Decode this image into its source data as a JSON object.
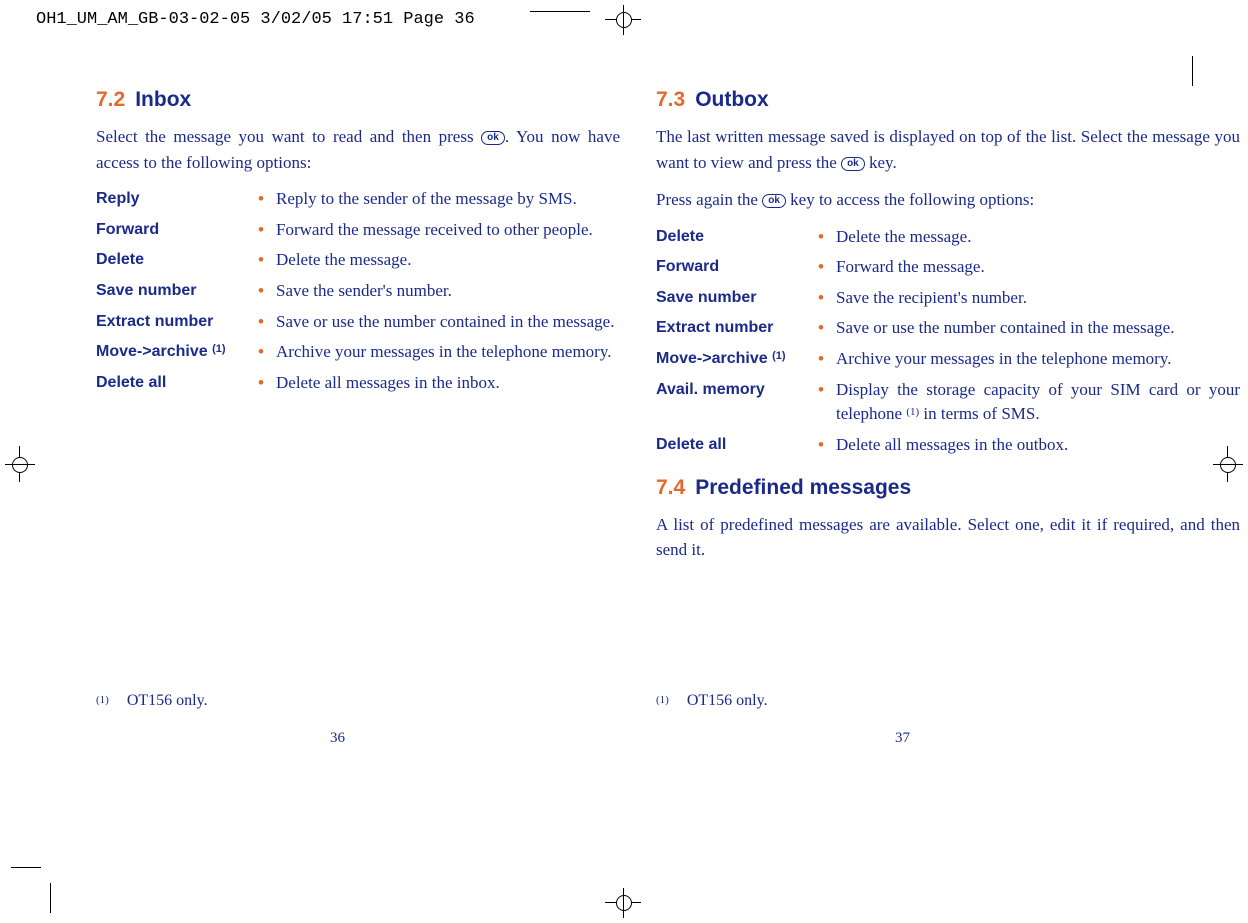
{
  "print_header": "OH1_UM_AM_GB-03-02-05   3/02/05  17:51  Page 36",
  "left": {
    "section_num": "7.2",
    "section_title": "Inbox",
    "intro_before_key": "Select the message you want to read and then press ",
    "ok_label": "ok",
    "intro_after_key": ". You now have access to the following options:",
    "options": [
      {
        "term": "Reply",
        "desc": "Reply to the sender of the message by SMS.",
        "justify": false
      },
      {
        "term": "Forward",
        "desc": "Forward the message received to other people.",
        "justify": false
      },
      {
        "term": "Delete",
        "desc": "Delete the message.",
        "justify": false
      },
      {
        "term": "Save number",
        "desc": "Save the sender's number.",
        "justify": false
      },
      {
        "term": "Extract number",
        "desc": "Save or use the number contained in the message.",
        "justify": true
      },
      {
        "term": "Move->archive (1)",
        "desc": "Archive your messages in the telephone memory.",
        "justify": true,
        "sup": true
      },
      {
        "term": "Delete all",
        "desc": "Delete all messages in the inbox.",
        "justify": false
      }
    ],
    "footnote_mark": "(1)",
    "footnote_text": "OT156 only.",
    "page_num": "36"
  },
  "right": {
    "section_num": "7.3",
    "section_title": "Outbox",
    "intro1_before": "The last written message saved is displayed on top of the list. Select the message you want to view and press the ",
    "ok_label": "ok",
    "intro1_after": " key.",
    "intro2_before": "Press again the ",
    "intro2_after": " key to access the following options:",
    "options": [
      {
        "term": "Delete",
        "desc": "Delete the message.",
        "justify": false
      },
      {
        "term": "Forward",
        "desc": "Forward the message.",
        "justify": false
      },
      {
        "term": "Save number",
        "desc": "Save the recipient's number.",
        "justify": false
      },
      {
        "term": "Extract number",
        "desc": "Save or use the number contained in the message.",
        "justify": true
      },
      {
        "term": "Move->archive (1)",
        "desc": "Archive your messages in the telephone memory.",
        "justify": true,
        "sup": true
      },
      {
        "term": "Avail. memory",
        "desc": "Display the storage capacity of your SIM card or your telephone (1) in terms of SMS.",
        "justify": true,
        "inlinesup": true
      },
      {
        "term": "Delete all",
        "desc": "Delete all messages in the outbox.",
        "justify": false
      }
    ],
    "section2_num": "7.4",
    "section2_title": "Predefined messages",
    "section2_body": "A list of predefined messages are available. Select one, edit it if required, and then send it.",
    "footnote_mark": "(1)",
    "footnote_text": "OT156 only.",
    "page_num": "37"
  }
}
